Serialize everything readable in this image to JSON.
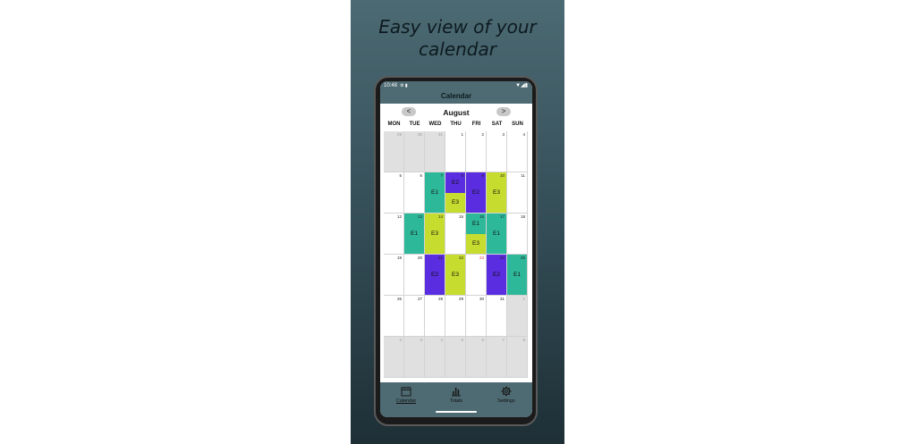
{
  "headline": {
    "line1": "Easy view of your",
    "line2": "calendar"
  },
  "status": {
    "time": "10:48"
  },
  "appbar": {
    "title": "Calendar"
  },
  "calendar": {
    "month": "August",
    "prev_label": "<",
    "next_label": ">",
    "weekdays": [
      "MON",
      "TUE",
      "WED",
      "THU",
      "FRI",
      "SAT",
      "SUN"
    ],
    "weeks": [
      [
        {
          "d": "29",
          "o": true
        },
        {
          "d": "30",
          "o": true
        },
        {
          "d": "31",
          "o": true
        },
        {
          "d": "1"
        },
        {
          "d": "2"
        },
        {
          "d": "3"
        },
        {
          "d": "4"
        }
      ],
      [
        {
          "d": "5"
        },
        {
          "d": "6"
        },
        {
          "d": "7",
          "ev": [
            {
              "l": "E1",
              "c": "#2eb89a"
            }
          ]
        },
        {
          "d": "8",
          "ev": [
            {
              "l": "E2",
              "c": "#5a2de0"
            },
            {
              "l": "E3",
              "c": "#c6dc2e"
            }
          ]
        },
        {
          "d": "9",
          "ev": [
            {
              "l": "E2",
              "c": "#5a2de0"
            }
          ]
        },
        {
          "d": "10",
          "ev": [
            {
              "l": "E3",
              "c": "#c6dc2e"
            }
          ]
        },
        {
          "d": "11"
        }
      ],
      [
        {
          "d": "12"
        },
        {
          "d": "13",
          "ev": [
            {
              "l": "E1",
              "c": "#2eb89a"
            }
          ]
        },
        {
          "d": "14",
          "ev": [
            {
              "l": "E3",
              "c": "#c6dc2e"
            }
          ]
        },
        {
          "d": "15"
        },
        {
          "d": "16",
          "ev": [
            {
              "l": "E1",
              "c": "#2eb89a"
            },
            {
              "l": "E3",
              "c": "#c6dc2e"
            }
          ]
        },
        {
          "d": "17",
          "ev": [
            {
              "l": "E1",
              "c": "#2eb89a"
            }
          ]
        },
        {
          "d": "18"
        }
      ],
      [
        {
          "d": "19"
        },
        {
          "d": "20"
        },
        {
          "d": "21",
          "ev": [
            {
              "l": "E2",
              "c": "#5a2de0"
            }
          ]
        },
        {
          "d": "22",
          "ev": [
            {
              "l": "E3",
              "c": "#c6dc2e"
            }
          ]
        },
        {
          "d": "23",
          "red": true
        },
        {
          "d": "24",
          "ev": [
            {
              "l": "E2",
              "c": "#5a2de0"
            }
          ]
        },
        {
          "d": "25",
          "ev": [
            {
              "l": "E1",
              "c": "#2eb89a"
            }
          ]
        }
      ],
      [
        {
          "d": "26"
        },
        {
          "d": "27"
        },
        {
          "d": "28"
        },
        {
          "d": "29"
        },
        {
          "d": "30"
        },
        {
          "d": "31"
        },
        {
          "d": "1",
          "o": true
        }
      ],
      [
        {
          "d": "2",
          "o": true
        },
        {
          "d": "3",
          "o": true
        },
        {
          "d": "4",
          "o": true
        },
        {
          "d": "5",
          "o": true
        },
        {
          "d": "6",
          "o": true
        },
        {
          "d": "7",
          "o": true
        },
        {
          "d": "8",
          "o": true
        }
      ]
    ]
  },
  "nav": {
    "calendar": "Calendar",
    "totals": "Totals",
    "settings": "Settings"
  },
  "colors": {
    "accent": "#4e6b73",
    "e1": "#2eb89a",
    "e2": "#5a2de0",
    "e3": "#c6dc2e"
  }
}
